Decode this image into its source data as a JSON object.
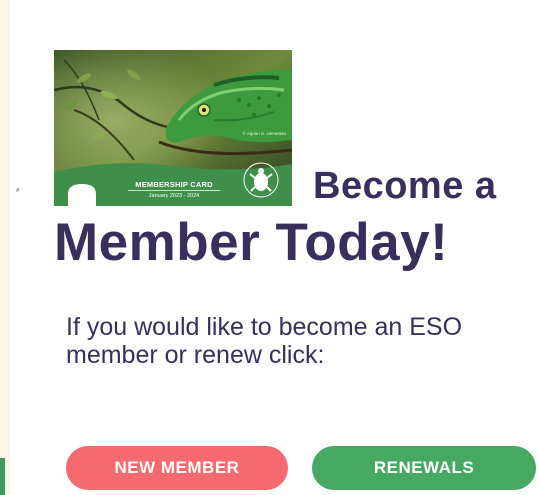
{
  "card": {
    "title": "MEMBERSHIP CARD",
    "date_range": "January 2023 - 2024",
    "credit": "© Aquan S. Uemettan",
    "number_prefix": "#",
    "band_color": "#3f8f4a"
  },
  "heading": {
    "line1": "Become a",
    "line2": "Member Today!"
  },
  "body_text": "If you would like to become an ESO member or renew click:",
  "buttons": {
    "new_member": "NEW MEMBER",
    "renewals": "RENEWALS"
  },
  "colors": {
    "heading": "#3a2f5c",
    "new_member_bg": "#f46a6e",
    "renewals_bg": "#47a864"
  }
}
